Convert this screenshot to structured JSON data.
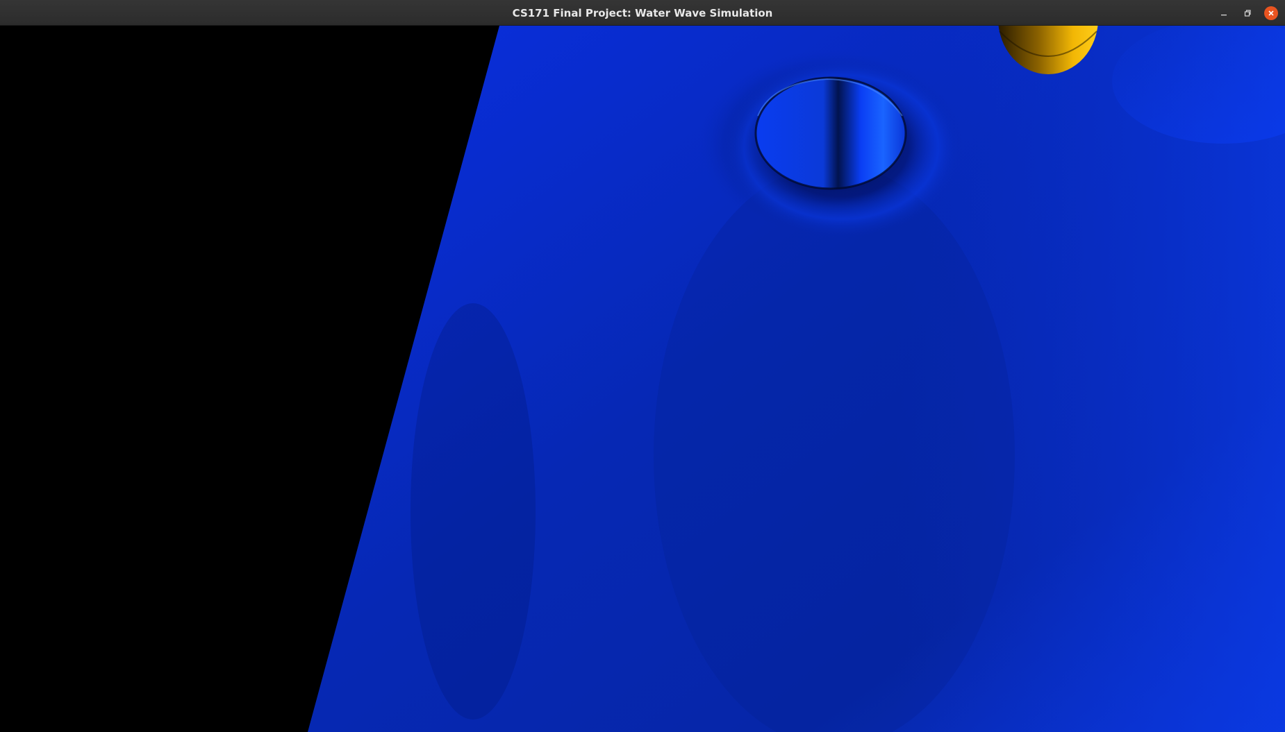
{
  "window": {
    "title": "CS171 Final Project: Water Wave Simulation"
  },
  "controls": {
    "minimize_icon": "minimize-icon",
    "maximize_icon": "restore-icon",
    "close_icon": "close-icon"
  },
  "scene": {
    "background_color": "#000000",
    "water_color": "#0a2fd6",
    "ball_color": "#f2b705",
    "accent_close_color": "#e95420"
  }
}
